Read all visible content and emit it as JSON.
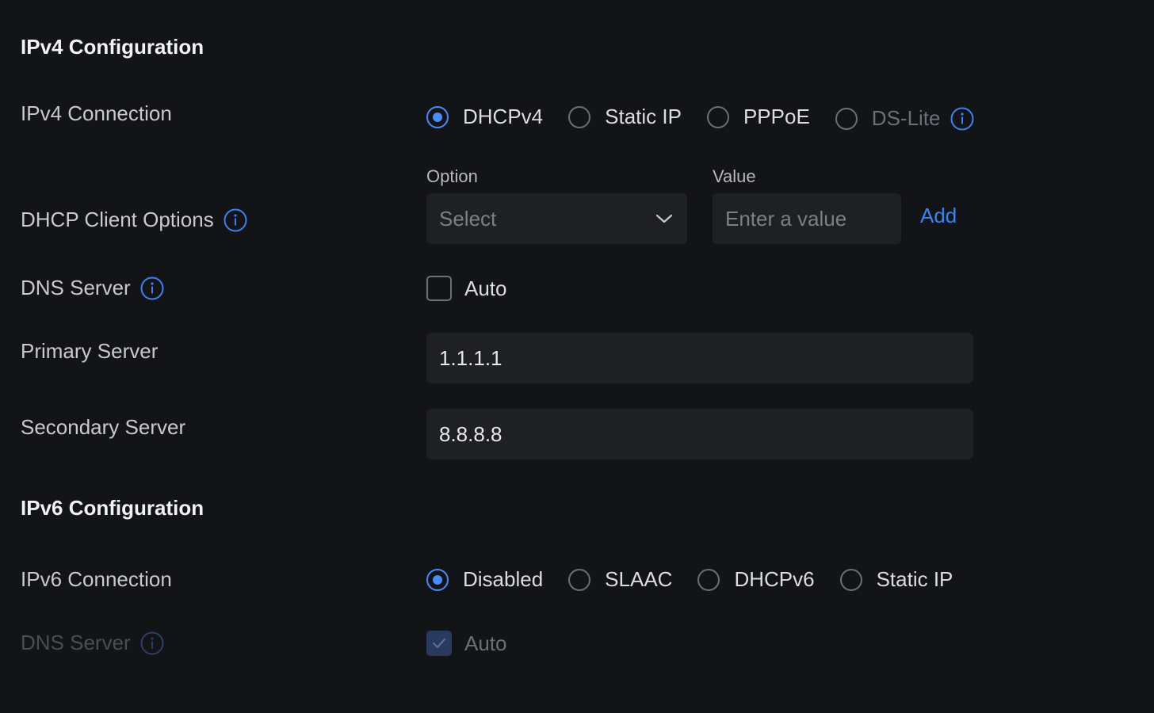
{
  "ipv4": {
    "title": "IPv4 Configuration",
    "connection_label": "IPv4 Connection",
    "connection_options": [
      "DHCPv4",
      "Static IP",
      "PPPoE",
      "DS-Lite"
    ],
    "connection_selected": "DHCPv4",
    "dhcp_options_label": "DHCP Client Options",
    "option_caption": "Option",
    "option_placeholder": "Select",
    "value_caption": "Value",
    "value_placeholder": "Enter a value",
    "add_label": "Add",
    "dns_label": "DNS Server",
    "dns_auto_label": "Auto",
    "dns_auto_checked": false,
    "primary_label": "Primary Server",
    "primary_value": "1.1.1.1",
    "secondary_label": "Secondary Server",
    "secondary_value": "8.8.8.8"
  },
  "ipv6": {
    "title": "IPv6 Configuration",
    "connection_label": "IPv6 Connection",
    "connection_options": [
      "Disabled",
      "SLAAC",
      "DHCPv6",
      "Static IP"
    ],
    "connection_selected": "Disabled",
    "dns_label": "DNS Server",
    "dns_auto_label": "Auto",
    "dns_auto_checked": true,
    "dns_disabled": true
  },
  "colors": {
    "background": "#131417",
    "accent": "#4a8bf5",
    "link": "#3d82f0",
    "input_bg": "#1f2024",
    "disabled_text": "#4a4d54"
  },
  "icons": [
    "info-icon",
    "chevron-down-icon",
    "check-icon"
  ]
}
